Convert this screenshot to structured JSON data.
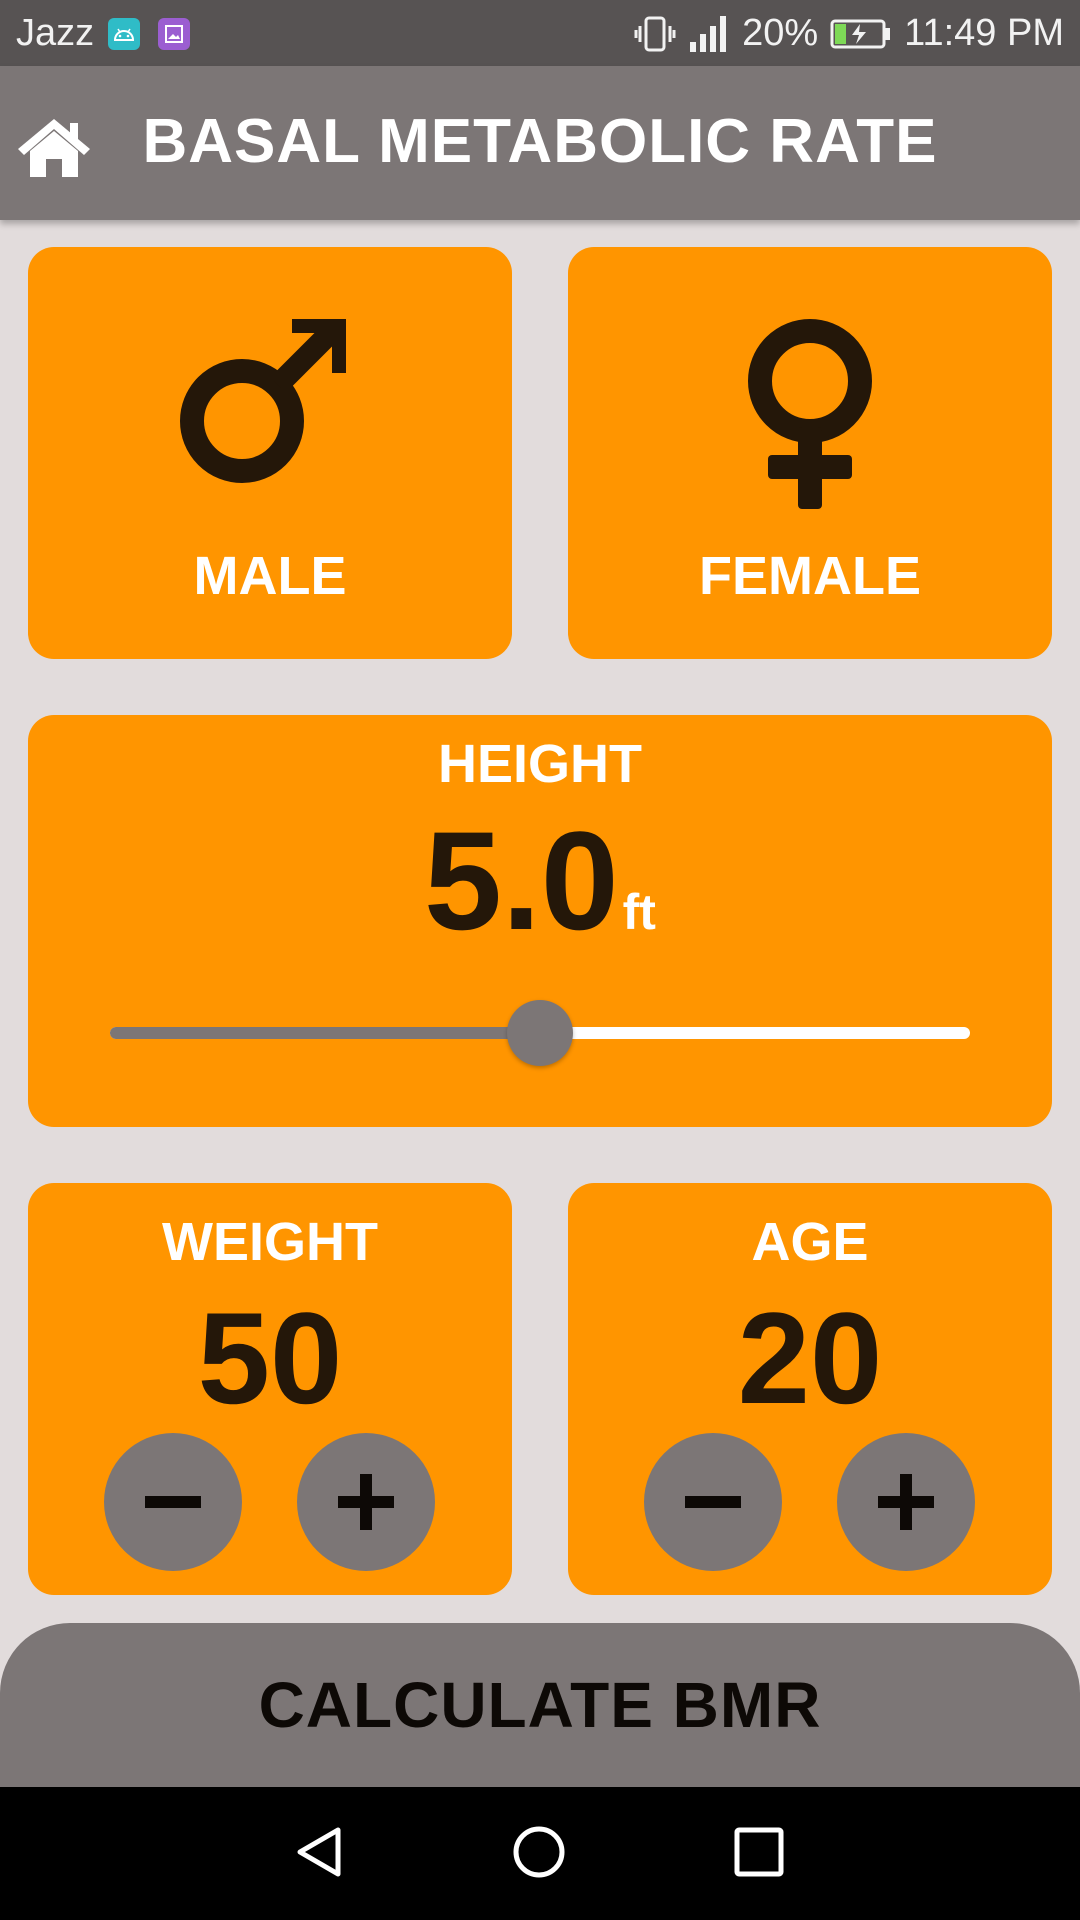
{
  "status_bar": {
    "carrier": "Jazz",
    "battery": "20%",
    "time": "11:49 PM",
    "notification_icons": [
      "android-icon",
      "photo-icon"
    ],
    "system_icons": [
      "vibrate-icon",
      "signal-icon",
      "battery-charging-icon"
    ]
  },
  "app_bar": {
    "title": "BASAL METABOLIC RATE",
    "home_icon": "home-icon"
  },
  "gender": {
    "male_label": "MALE",
    "male_icon": "male-symbol-icon",
    "female_label": "FEMALE",
    "female_icon": "female-symbol-icon"
  },
  "height": {
    "label": "HEIGHT",
    "value": "5.0",
    "unit": "ft",
    "slider_fraction": 0.5
  },
  "weight": {
    "label": "WEIGHT",
    "value": "50",
    "minus_icon": "minus-icon",
    "plus_icon": "plus-icon"
  },
  "age": {
    "label": "AGE",
    "value": "20",
    "minus_icon": "minus-icon",
    "plus_icon": "plus-icon"
  },
  "calculate_button": {
    "label": "CALCULATE BMR"
  },
  "nav_bar": {
    "icons": [
      "back-icon",
      "home-circle-icon",
      "recents-icon"
    ]
  },
  "colors": {
    "accent": "#ff9500",
    "app_bar": "#7c7676",
    "background": "#e2dcdc",
    "value_text": "#241709"
  }
}
